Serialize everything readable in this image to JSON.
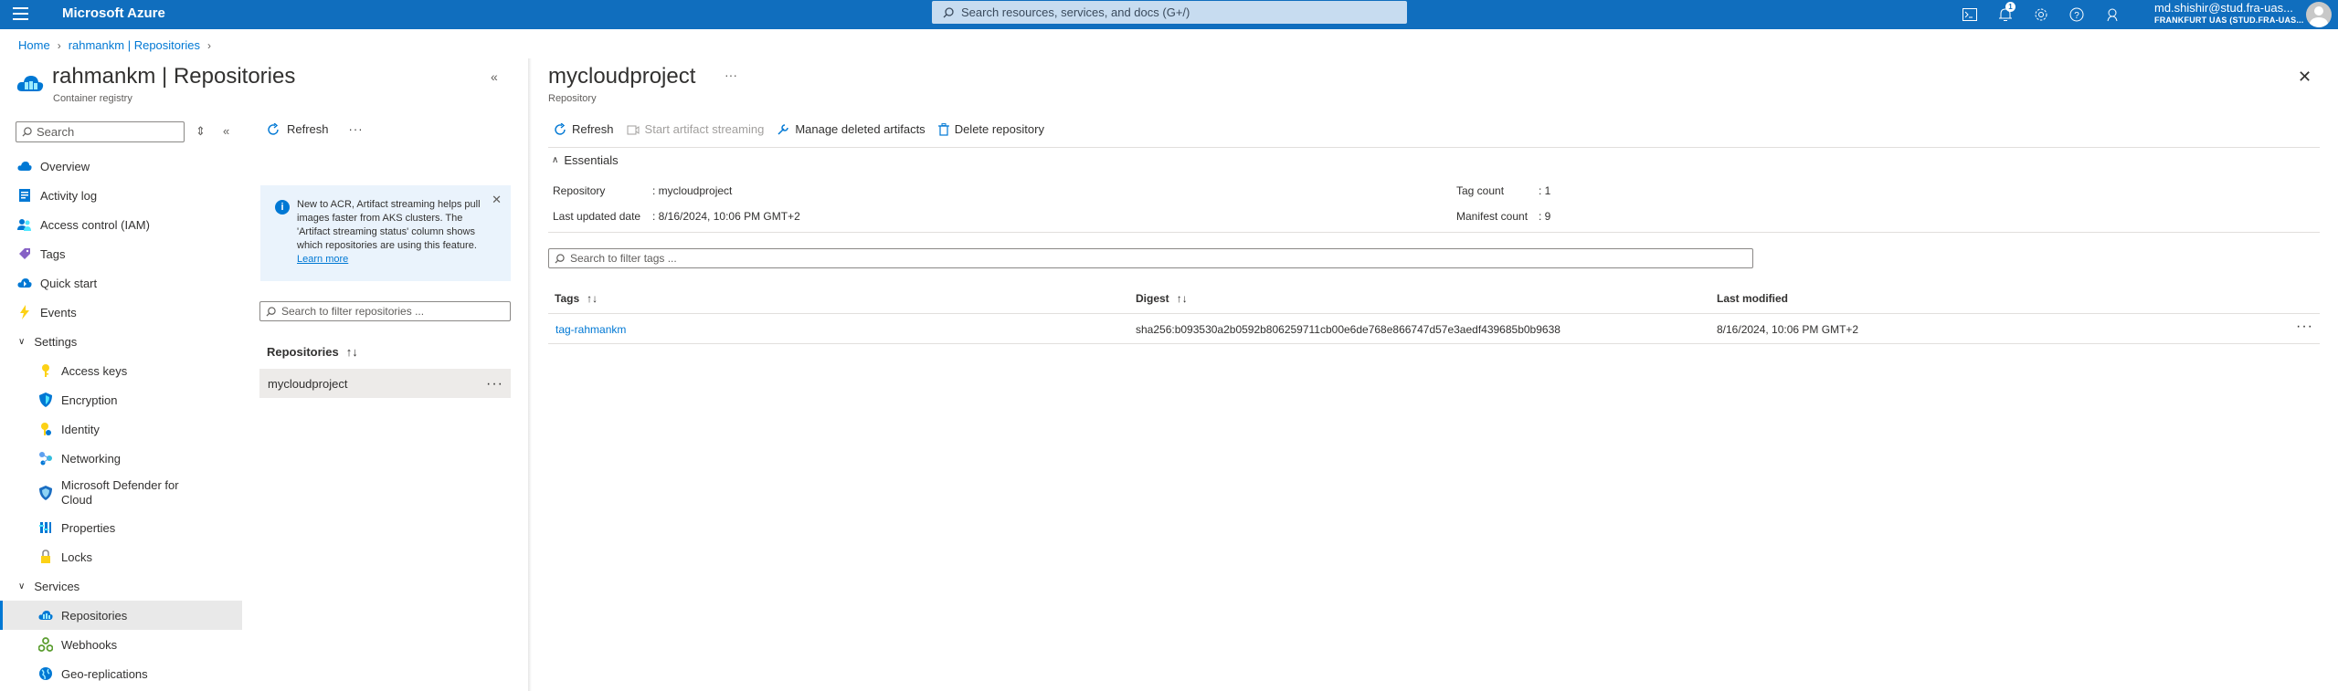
{
  "topbar": {
    "brand": "Microsoft Azure",
    "search_placeholder": "Search resources, services, and docs (G+/)",
    "notification_count": "1",
    "user_email": "md.shishir@stud.fra-uas...",
    "user_tenant": "FRANKFURT UAS (STUD.FRA-UAS..."
  },
  "breadcrumb": {
    "home": "Home",
    "current": "rahmankm | Repositories"
  },
  "resource": {
    "title": "rahmankm | Repositories",
    "subtitle": "Container registry"
  },
  "sidebar": {
    "search_placeholder": "Search",
    "items": [
      {
        "label": "Overview",
        "icon": "cloud-icon"
      },
      {
        "label": "Activity log",
        "icon": "activity-log-icon"
      },
      {
        "label": "Access control (IAM)",
        "icon": "iam-icon"
      },
      {
        "label": "Tags",
        "icon": "tag-icon"
      },
      {
        "label": "Quick start",
        "icon": "quick-start-icon"
      },
      {
        "label": "Events",
        "icon": "lightning-icon"
      }
    ],
    "settings_label": "Settings",
    "settings_items": [
      {
        "label": "Access keys",
        "icon": "key-icon"
      },
      {
        "label": "Encryption",
        "icon": "shield-icon"
      },
      {
        "label": "Identity",
        "icon": "identity-icon"
      },
      {
        "label": "Networking",
        "icon": "networking-icon"
      },
      {
        "label": "Microsoft Defender for",
        "label2": "Cloud",
        "icon": "defender-icon"
      },
      {
        "label": "Properties",
        "icon": "properties-icon"
      },
      {
        "label": "Locks",
        "icon": "lock-icon"
      }
    ],
    "services_label": "Services",
    "services_items": [
      {
        "label": "Repositories",
        "icon": "repositories-icon"
      },
      {
        "label": "Webhooks",
        "icon": "webhooks-icon"
      },
      {
        "label": "Geo-replications",
        "icon": "geo-replications-icon"
      }
    ]
  },
  "middle": {
    "refresh_label": "Refresh",
    "info_text": "New to ACR, Artifact streaming helps pull images faster from AKS clusters. The 'Artifact streaming status' column shows which repositories are using this feature.",
    "info_link": "Learn more",
    "search_placeholder": "Search to filter repositories ...",
    "column_header": "Repositories",
    "repositories": [
      "mycloudproject"
    ]
  },
  "detail": {
    "title": "mycloudproject",
    "subtitle": "Repository",
    "toolbar": {
      "refresh": "Refresh",
      "start_streaming": "Start artifact streaming",
      "manage_deleted": "Manage deleted artifacts",
      "delete": "Delete repository"
    },
    "essentials_label": "Essentials",
    "essentials": {
      "repository_key": "Repository",
      "repository_value": "mycloudproject",
      "last_updated_key": "Last updated date",
      "last_updated_value": "8/16/2024, 10:06 PM GMT+2",
      "tag_count_key": "Tag count",
      "tag_count_value": "1",
      "manifest_count_key": "Manifest count",
      "manifest_count_value": "9"
    },
    "filter_placeholder": "Search to filter tags ...",
    "table": {
      "headers": [
        "Tags",
        "Digest",
        "Last modified"
      ],
      "rows": [
        {
          "tag": "tag-rahmankm",
          "digest": "sha256:b093530a2b0592b806259711cb00e6de768e866747d57e3aedf439685b0b9638",
          "last_modified": "8/16/2024, 10:06 PM GMT+2"
        }
      ]
    }
  }
}
